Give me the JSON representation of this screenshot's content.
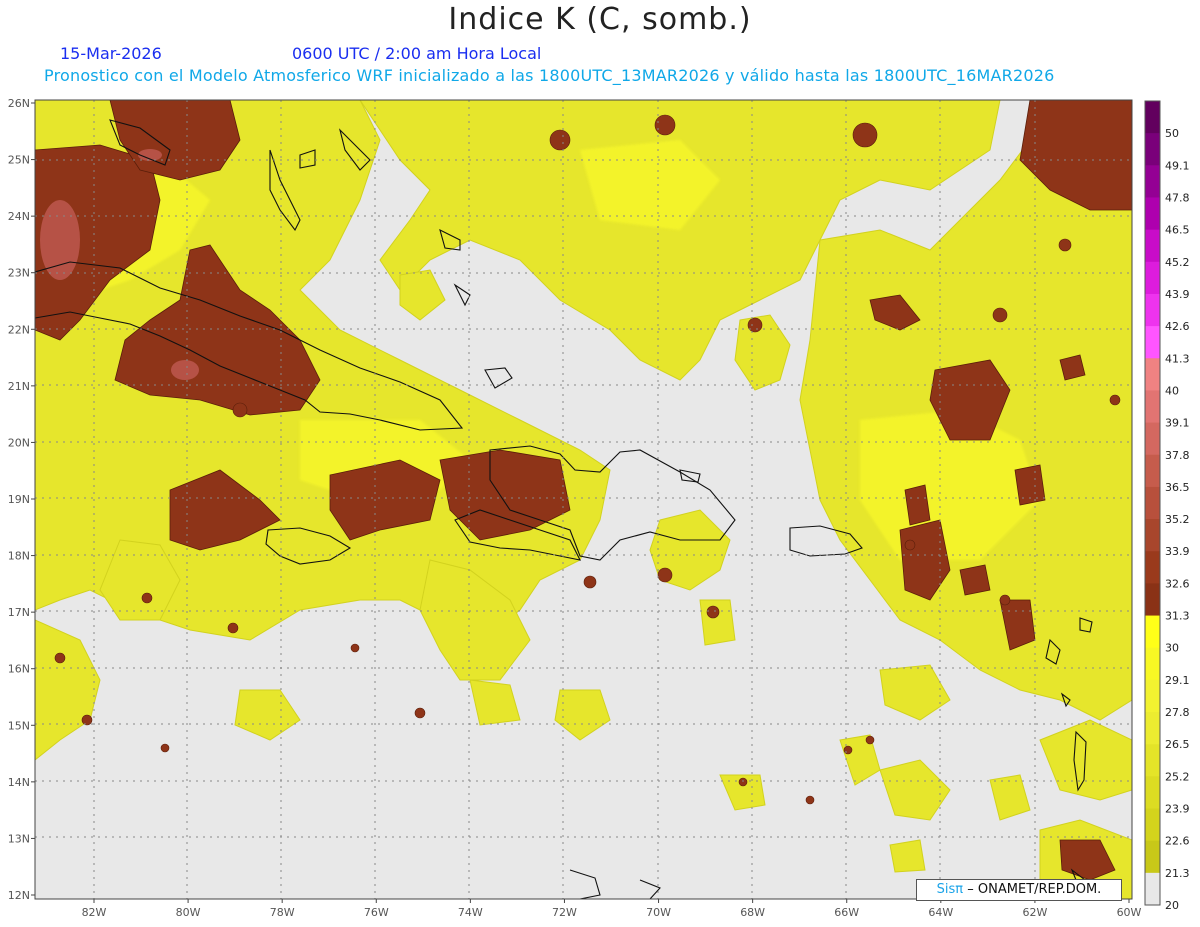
{
  "header": {
    "title": "Indice K (C, somb.)",
    "date": "15-Mar-2026",
    "time": "0600 UTC / 2:00 am Hora Local",
    "subtitle": "Pronostico con el Modelo Atmosferico WRF inicializado a las 1800UTC_13MAR2026 y válido hasta las  1800UTC_16MAR2026"
  },
  "map": {
    "lat_labels": [
      "26N",
      "25N",
      "24N",
      "23N",
      "22N",
      "21N",
      "20N",
      "19N",
      "18N",
      "17N",
      "16N",
      "15N",
      "14N",
      "13N",
      "12N"
    ],
    "lon_labels": [
      "82W",
      "80W",
      "78W",
      "76W",
      "74W",
      "72W",
      "70W",
      "68W",
      "66W",
      "64W",
      "62W",
      "60W"
    ],
    "lat_range": [
      12,
      26
    ],
    "lon_range": [
      -83.2,
      -60
    ],
    "ocean_color": "#e8e8e8"
  },
  "colorbar": {
    "labels": [
      "50",
      "49.1",
      "47.8",
      "46.5",
      "45.2",
      "43.9",
      "42.6",
      "41.3",
      "40",
      "39.1",
      "37.8",
      "36.5",
      "35.2",
      "33.9",
      "32.6",
      "31.3",
      "30",
      "29.1",
      "27.8",
      "26.5",
      "25.2",
      "23.9",
      "22.6",
      "21.3",
      "20"
    ],
    "colors": [
      "#ffffff",
      "#c0c000",
      "#cccc10",
      "#d6d620",
      "#e0e030",
      "#eaea30",
      "#f2f230",
      "#f8f820",
      "#ffff10",
      "#8a3010",
      "#9a3818",
      "#a84028",
      "#b84c38",
      "#c85c50",
      "#d86a68",
      "#e87878",
      "#f48888",
      "#ff44ff",
      "#ee22ee",
      "#dd10dd",
      "#c408c4",
      "#aa00aa",
      "#900090",
      "#780078",
      "#600060"
    ],
    "pos_colors": [
      "#c8c818",
      "#d4d41c",
      "#dcdc22",
      "#e4e428",
      "#ecec30",
      "#f2f230",
      "#f8f824",
      "#ffff18",
      "#8a3216",
      "#9a3a1c",
      "#a8462c",
      "#b8503c",
      "#c65c4c",
      "#d46860",
      "#e27472",
      "#f08282",
      "#ff55ff",
      "#ee33ee",
      "#dd1cdd",
      "#c80cc8",
      "#ae00ae",
      "#940094",
      "#7a007a",
      "#62005e"
    ]
  },
  "credit": {
    "sis": "Sisπ",
    "rest": "– ONAMET/REP.DOM."
  }
}
